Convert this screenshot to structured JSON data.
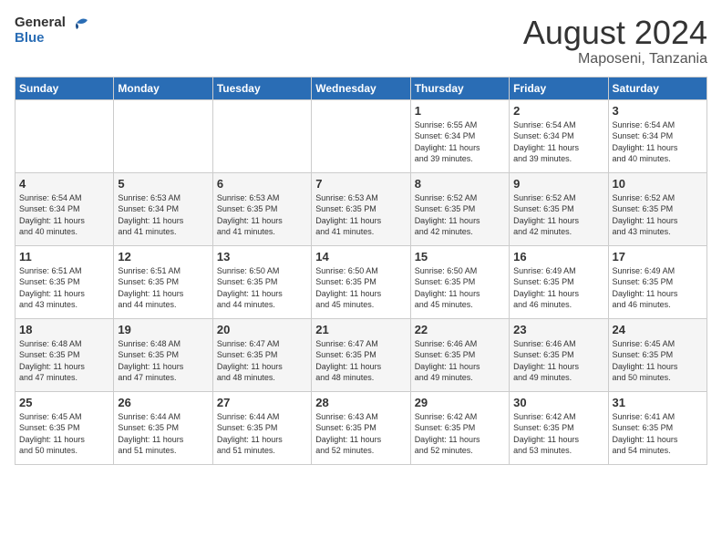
{
  "header": {
    "logo_general": "General",
    "logo_blue": "Blue",
    "month_title": "August 2024",
    "location": "Maposeni, Tanzania"
  },
  "days_of_week": [
    "Sunday",
    "Monday",
    "Tuesday",
    "Wednesday",
    "Thursday",
    "Friday",
    "Saturday"
  ],
  "weeks": [
    [
      {
        "day": "",
        "info": ""
      },
      {
        "day": "",
        "info": ""
      },
      {
        "day": "",
        "info": ""
      },
      {
        "day": "",
        "info": ""
      },
      {
        "day": "1",
        "info": "Sunrise: 6:55 AM\nSunset: 6:34 PM\nDaylight: 11 hours\nand 39 minutes."
      },
      {
        "day": "2",
        "info": "Sunrise: 6:54 AM\nSunset: 6:34 PM\nDaylight: 11 hours\nand 39 minutes."
      },
      {
        "day": "3",
        "info": "Sunrise: 6:54 AM\nSunset: 6:34 PM\nDaylight: 11 hours\nand 40 minutes."
      }
    ],
    [
      {
        "day": "4",
        "info": "Sunrise: 6:54 AM\nSunset: 6:34 PM\nDaylight: 11 hours\nand 40 minutes."
      },
      {
        "day": "5",
        "info": "Sunrise: 6:53 AM\nSunset: 6:34 PM\nDaylight: 11 hours\nand 41 minutes."
      },
      {
        "day": "6",
        "info": "Sunrise: 6:53 AM\nSunset: 6:35 PM\nDaylight: 11 hours\nand 41 minutes."
      },
      {
        "day": "7",
        "info": "Sunrise: 6:53 AM\nSunset: 6:35 PM\nDaylight: 11 hours\nand 41 minutes."
      },
      {
        "day": "8",
        "info": "Sunrise: 6:52 AM\nSunset: 6:35 PM\nDaylight: 11 hours\nand 42 minutes."
      },
      {
        "day": "9",
        "info": "Sunrise: 6:52 AM\nSunset: 6:35 PM\nDaylight: 11 hours\nand 42 minutes."
      },
      {
        "day": "10",
        "info": "Sunrise: 6:52 AM\nSunset: 6:35 PM\nDaylight: 11 hours\nand 43 minutes."
      }
    ],
    [
      {
        "day": "11",
        "info": "Sunrise: 6:51 AM\nSunset: 6:35 PM\nDaylight: 11 hours\nand 43 minutes."
      },
      {
        "day": "12",
        "info": "Sunrise: 6:51 AM\nSunset: 6:35 PM\nDaylight: 11 hours\nand 44 minutes."
      },
      {
        "day": "13",
        "info": "Sunrise: 6:50 AM\nSunset: 6:35 PM\nDaylight: 11 hours\nand 44 minutes."
      },
      {
        "day": "14",
        "info": "Sunrise: 6:50 AM\nSunset: 6:35 PM\nDaylight: 11 hours\nand 45 minutes."
      },
      {
        "day": "15",
        "info": "Sunrise: 6:50 AM\nSunset: 6:35 PM\nDaylight: 11 hours\nand 45 minutes."
      },
      {
        "day": "16",
        "info": "Sunrise: 6:49 AM\nSunset: 6:35 PM\nDaylight: 11 hours\nand 46 minutes."
      },
      {
        "day": "17",
        "info": "Sunrise: 6:49 AM\nSunset: 6:35 PM\nDaylight: 11 hours\nand 46 minutes."
      }
    ],
    [
      {
        "day": "18",
        "info": "Sunrise: 6:48 AM\nSunset: 6:35 PM\nDaylight: 11 hours\nand 47 minutes."
      },
      {
        "day": "19",
        "info": "Sunrise: 6:48 AM\nSunset: 6:35 PM\nDaylight: 11 hours\nand 47 minutes."
      },
      {
        "day": "20",
        "info": "Sunrise: 6:47 AM\nSunset: 6:35 PM\nDaylight: 11 hours\nand 48 minutes."
      },
      {
        "day": "21",
        "info": "Sunrise: 6:47 AM\nSunset: 6:35 PM\nDaylight: 11 hours\nand 48 minutes."
      },
      {
        "day": "22",
        "info": "Sunrise: 6:46 AM\nSunset: 6:35 PM\nDaylight: 11 hours\nand 49 minutes."
      },
      {
        "day": "23",
        "info": "Sunrise: 6:46 AM\nSunset: 6:35 PM\nDaylight: 11 hours\nand 49 minutes."
      },
      {
        "day": "24",
        "info": "Sunrise: 6:45 AM\nSunset: 6:35 PM\nDaylight: 11 hours\nand 50 minutes."
      }
    ],
    [
      {
        "day": "25",
        "info": "Sunrise: 6:45 AM\nSunset: 6:35 PM\nDaylight: 11 hours\nand 50 minutes."
      },
      {
        "day": "26",
        "info": "Sunrise: 6:44 AM\nSunset: 6:35 PM\nDaylight: 11 hours\nand 51 minutes."
      },
      {
        "day": "27",
        "info": "Sunrise: 6:44 AM\nSunset: 6:35 PM\nDaylight: 11 hours\nand 51 minutes."
      },
      {
        "day": "28",
        "info": "Sunrise: 6:43 AM\nSunset: 6:35 PM\nDaylight: 11 hours\nand 52 minutes."
      },
      {
        "day": "29",
        "info": "Sunrise: 6:42 AM\nSunset: 6:35 PM\nDaylight: 11 hours\nand 52 minutes."
      },
      {
        "day": "30",
        "info": "Sunrise: 6:42 AM\nSunset: 6:35 PM\nDaylight: 11 hours\nand 53 minutes."
      },
      {
        "day": "31",
        "info": "Sunrise: 6:41 AM\nSunset: 6:35 PM\nDaylight: 11 hours\nand 54 minutes."
      }
    ]
  ]
}
